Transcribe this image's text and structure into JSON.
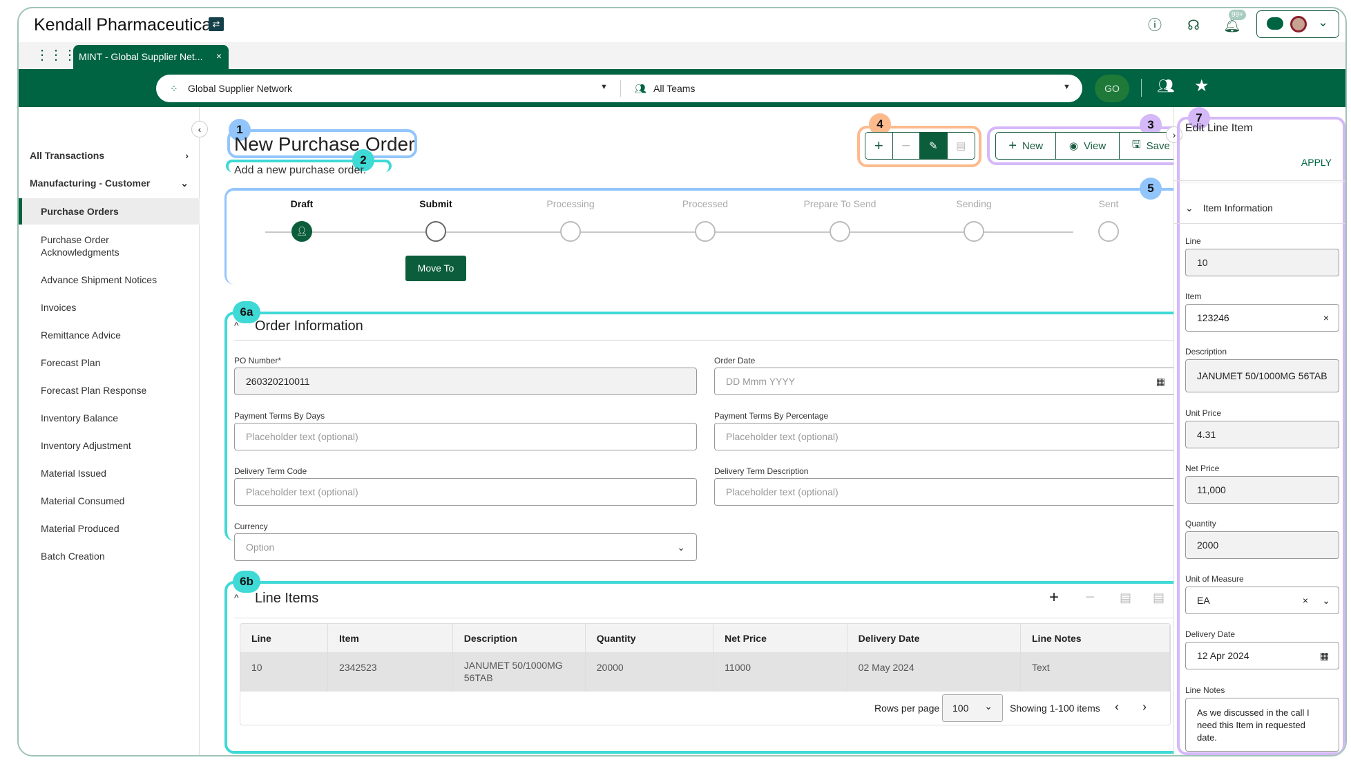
{
  "header": {
    "brand": "Kendall Pharmaceuticals",
    "notification_count": "99+",
    "icons": [
      "help-icon",
      "headset-icon",
      "bell-icon",
      "cloud-icon",
      "avatar",
      "chevron-down-icon"
    ]
  },
  "tabs": [
    {
      "label": "MINT - Global Supplier Net...",
      "close": "×"
    }
  ],
  "context_bar": {
    "network": "Global Supplier Network",
    "team": "All Teams",
    "go": "GO"
  },
  "sidebar": {
    "groups": [
      {
        "label": "All Transactions"
      },
      {
        "label": "Manufacturing - Customer"
      }
    ],
    "items": [
      "Purchase Orders",
      "Purchase Order Acknowledgments",
      "Advance Shipment Notices",
      "Invoices",
      "Remittance Advice",
      "Forecast Plan",
      "Forecast Plan Response",
      "Inventory Balance",
      "Inventory Adjustment",
      "Material Issued",
      "Material Consumed",
      "Material Produced",
      "Batch Creation"
    ],
    "selected": "Purchase Orders"
  },
  "page": {
    "title": "New Purchase Order",
    "subtitle": "Add a new purchase order."
  },
  "toolbar": {
    "new": "New",
    "view": "View",
    "save": "Save"
  },
  "annotations": [
    "1",
    "2",
    "3",
    "4",
    "5",
    "6a",
    "6b",
    "7"
  ],
  "stepper": {
    "steps": [
      "Draft",
      "Submit",
      "Processing",
      "Processed",
      "Prepare To Send",
      "Sending",
      "Sent"
    ],
    "current": 0,
    "move_to": "Move To"
  },
  "order_info": {
    "title": "Order Information",
    "fields": [
      {
        "label": "PO Number*",
        "value": "260320210011"
      },
      {
        "label": "Order Date",
        "placeholder": "DD Mmm YYYY"
      },
      {
        "label": "Payment Terms By Days",
        "placeholder": "Placeholder text (optional)"
      },
      {
        "label": "Payment Terms By Percentage",
        "placeholder": "Placeholder text (optional)"
      },
      {
        "label": "Delivery Term Code",
        "placeholder": "Placeholder text (optional)"
      },
      {
        "label": "Delivery Term Description",
        "placeholder": "Placeholder text (optional)"
      },
      {
        "label": "Currency",
        "placeholder": "Option"
      }
    ]
  },
  "line_items": {
    "title": "Line Items",
    "columns": [
      "Line",
      "Item",
      "Description",
      "Quantity",
      "Net Price",
      "Delivery Date",
      "Line Notes"
    ],
    "rows": [
      [
        "10",
        "2342523",
        "JANUMET 50/1000MG 56TAB",
        "20000",
        "11000",
        "02 May 2024",
        "Text"
      ]
    ],
    "rows_per_page_label": "Rows per page",
    "rows_per_page": "100",
    "showing": "Showing 1-100 items"
  },
  "edit_panel": {
    "title": "Edit Line Item",
    "apply": "APPLY",
    "section": "Item Information",
    "fields": [
      {
        "label": "Line",
        "value": "10"
      },
      {
        "label": "Item",
        "value": "123246"
      },
      {
        "label": "Description",
        "value": "JANUMET 50/1000MG 56TAB"
      },
      {
        "label": "Unit Price",
        "value": "4.31"
      },
      {
        "label": "Net Price",
        "value": "11,000"
      },
      {
        "label": "Quantity",
        "value": "2000"
      },
      {
        "label": "Unit of Measure",
        "value": "EA"
      },
      {
        "label": "Delivery Date",
        "value": "12 Apr 2024"
      },
      {
        "label": "Line Notes",
        "value": "As we discussed in the call I need this Item in requested date."
      }
    ]
  },
  "colors": {
    "brand_green": "#006341",
    "go_green": "#1f7a3a",
    "anno_blue": "#93c5fd",
    "anno_purple": "#d4b8f8",
    "anno_orange": "#fdba8c",
    "anno_teal": "#3fd9d6"
  }
}
